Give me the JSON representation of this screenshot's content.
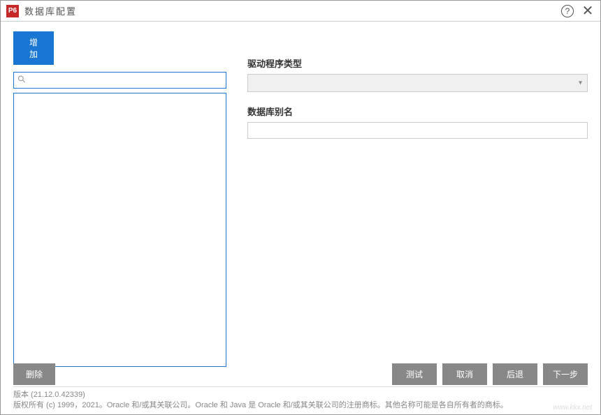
{
  "window": {
    "icon_text": "P6",
    "title": "数据库配置"
  },
  "toolbar": {
    "add_label": "增加"
  },
  "search": {
    "value": "",
    "placeholder": ""
  },
  "form": {
    "driver_type_label": "驱动程序类型",
    "driver_type_value": "",
    "db_alias_label": "数据库别名",
    "db_alias_value": ""
  },
  "footer_buttons": {
    "delete_label": "删除",
    "test_label": "测试",
    "cancel_label": "取消",
    "back_label": "后退",
    "next_label": "下一步"
  },
  "footer_info": {
    "version_line": "版本 (21.12.0.42339)",
    "copyright_line": "版权所有 (c) 1999，2021。Oracle 和/或其关联公司。Oracle 和 Java 是 Oracle 和/或其关联公司的注册商标。其他名称可能是各自所有者的商标。"
  },
  "watermark": "www.kkx.net"
}
